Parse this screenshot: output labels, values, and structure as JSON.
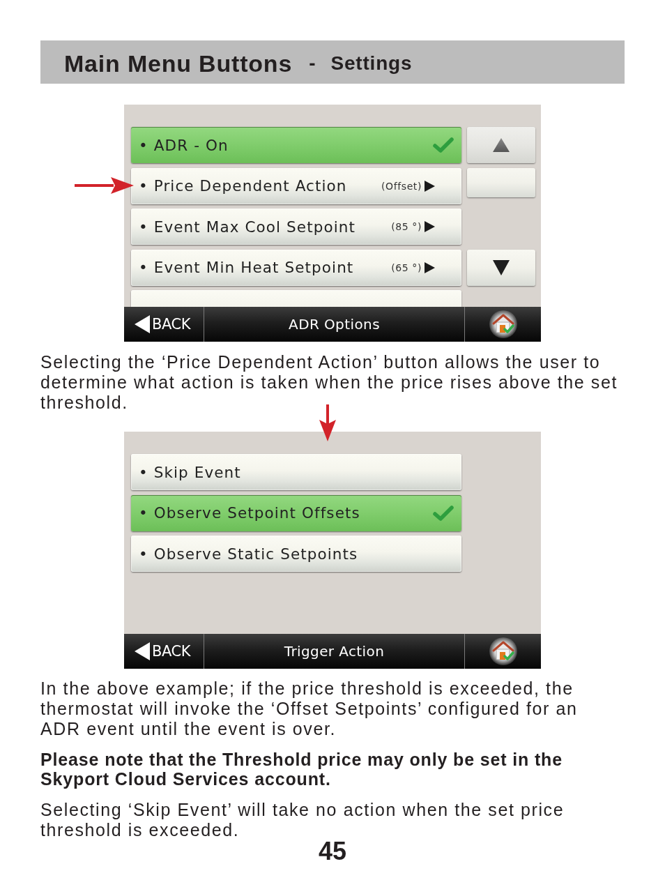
{
  "header": {
    "title": "Main Menu Buttons",
    "separator": "-",
    "subtitle": "Settings"
  },
  "content": [
    {
      "kind": "screen",
      "arrow": {
        "kind": "left"
      },
      "items": [
        {
          "kind": "option",
          "label": "• ADR - On",
          "selected": true
        },
        {
          "kind": "submenu",
          "label": "• Price Dependent Action",
          "detail": "(Offset)",
          "selected": false
        },
        {
          "kind": "submenu",
          "label": "• Event Max Cool Setpoint",
          "detail": "(85 °)",
          "selected": false
        },
        {
          "kind": "submenu",
          "label": "• Event Min Heat Setpoint",
          "detail": "(65 °)",
          "selected": false
        },
        {
          "kind": "partial",
          "selected": false
        }
      ],
      "scroll_buttons": [
        {
          "kind": "up"
        },
        {
          "kind": "blank"
        },
        {
          "kind": "down"
        }
      ],
      "bar": {
        "back": "BACK",
        "title": "ADR Options"
      }
    },
    {
      "kind": "text",
      "text": "Selecting the ‘Price Dependent Action’ button allows the user to determine what action is taken when the price rises above the set threshold."
    },
    {
      "kind": "screen",
      "arrow": {
        "kind": "down"
      },
      "items": [
        {
          "kind": "option",
          "label": "• Skip Event",
          "selected": false
        },
        {
          "kind": "option",
          "label": "• Observe Setpoint Offsets",
          "selected": true
        },
        {
          "kind": "option",
          "label": "• Observe Static Setpoints",
          "selected": false
        }
      ],
      "bar": {
        "back": "BACK",
        "title": "Trigger Action"
      }
    },
    {
      "kind": "text",
      "text": "In the above example; if the price threshold is exceeded, the thermostat will invoke the ‘Offset Setpoints’ configured for an ADR event until the event is over."
    },
    {
      "kind": "note",
      "text": "Please note that the Threshold price may only be set in the Skyport Cloud Services account."
    },
    {
      "kind": "text",
      "text": "Selecting ‘Skip Event’ will take no action when the set price threshold is exceeded."
    }
  ],
  "page_number": "45"
}
